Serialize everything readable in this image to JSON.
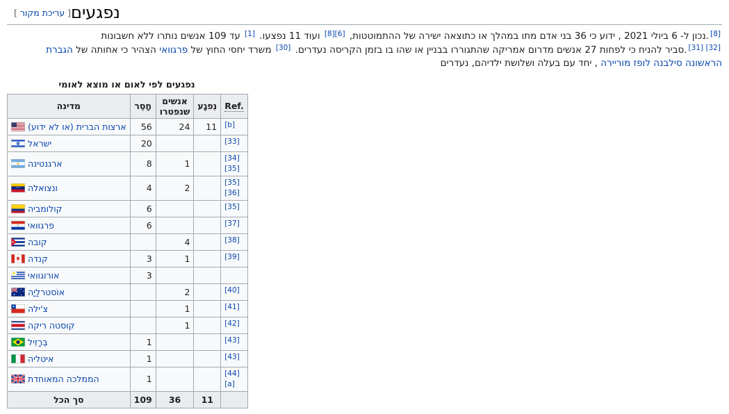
{
  "heading": {
    "title": "נפגעים",
    "edit_open": "[ ",
    "edit_label": "עריכת מקור",
    "edit_close": " ]"
  },
  "paragraph": {
    "line1": [
      {
        "type": "ref",
        "text": "[8]"
      },
      {
        "type": "text",
        "text": ".נכון ל- 6 ביולי 2021 , ידוע כי 36 בני אדם מתו במהלך או כתוצאה ישירה של ההתמוטטות, "
      },
      {
        "type": "ref",
        "text": "[8][6]"
      },
      {
        "type": "text",
        "text": " ועוד 11 נפצעו. "
      },
      {
        "type": "ref",
        "text": "[1]"
      },
      {
        "type": "text",
        "text": " עד 109 אנשים נותרו ללא חשבונות"
      }
    ],
    "line2": [
      {
        "type": "ref",
        "text": "[31] [32]"
      },
      {
        "type": "text",
        "text": ".סביר להניח כי לפחות 27 אנשים מדרום אמריקה שהתגוררו בבניין או שהו בו בזמן הקריסה נעדרים. "
      },
      {
        "type": "ref",
        "text": "[30]"
      },
      {
        "type": "text",
        "text": " משרד יחסי החוץ של "
      },
      {
        "type": "link",
        "text": "פרגוואי"
      },
      {
        "type": "text",
        "text": " הצהיר כי אחותה של "
      },
      {
        "type": "link",
        "text": "הגברת הראשונה סילבנה לופז מוריירה"
      },
      {
        "type": "text",
        "text": " , יחד עם בעלה ושלושת ילדיהם, נעדרים"
      }
    ]
  },
  "table": {
    "caption": "נפגעים לפי לאום או מוצא לאומי",
    "headers": {
      "country": "מדינה",
      "missing": "חָסֵר",
      "died": "אנשים שנפטרו",
      "injured": "נִפגָע",
      "ref": "Ref."
    },
    "rows": [
      {
        "flag": "us",
        "country": "ארצות הברית (או לא ידוע)",
        "missing": "56",
        "died": "24",
        "injured": "11",
        "refs": [
          "[b]"
        ]
      },
      {
        "flag": "il",
        "country": "ישראל",
        "missing": "20",
        "died": "",
        "injured": "",
        "refs": [
          "[33]"
        ]
      },
      {
        "flag": "ar",
        "country": "ארגנטינה",
        "missing": "8",
        "died": "1",
        "injured": "",
        "refs": [
          "[34]",
          "[35]"
        ]
      },
      {
        "flag": "ve",
        "country": "ונצואלה",
        "missing": "4",
        "died": "2",
        "injured": "",
        "refs": [
          "[35]",
          "[36]"
        ]
      },
      {
        "flag": "co",
        "country": "קולומביה",
        "missing": "6",
        "died": "",
        "injured": "",
        "refs": [
          "[35]"
        ]
      },
      {
        "flag": "py",
        "country": "פרגוואי",
        "missing": "6",
        "died": "",
        "injured": "",
        "refs": [
          "[37]"
        ]
      },
      {
        "flag": "cu",
        "country": "קובה",
        "missing": "",
        "died": "4",
        "injured": "",
        "refs": [
          "[38]"
        ]
      },
      {
        "flag": "ca",
        "country": "קנדה",
        "missing": "3",
        "died": "1",
        "injured": "",
        "refs": [
          "[39]"
        ]
      },
      {
        "flag": "uy",
        "country": "אורוגוואי",
        "missing": "3",
        "died": "",
        "injured": "",
        "refs": []
      },
      {
        "flag": "au",
        "country": "אוֹסטרלַיָה",
        "missing": "",
        "died": "2",
        "injured": "",
        "refs": [
          "[40]"
        ]
      },
      {
        "flag": "cl",
        "country": "צ'ילה",
        "missing": "",
        "died": "1",
        "injured": "",
        "refs": [
          "[41]"
        ]
      },
      {
        "flag": "cr",
        "country": "קוסטה ריקה",
        "missing": "",
        "died": "1",
        "injured": "",
        "refs": [
          "[42]"
        ]
      },
      {
        "flag": "br",
        "country": "בְּרָזִיל",
        "missing": "1",
        "died": "",
        "injured": "",
        "refs": [
          "[43]"
        ]
      },
      {
        "flag": "it",
        "country": "איטליה",
        "missing": "1",
        "died": "",
        "injured": "",
        "refs": [
          "[43]"
        ]
      },
      {
        "flag": "gb",
        "country": "הממלכה המאוחדת",
        "missing": "1",
        "died": "",
        "injured": "",
        "refs": [
          "[44]",
          "[a]"
        ]
      }
    ],
    "total": {
      "label": "סך הכל",
      "missing": "109",
      "died": "36",
      "injured": "11"
    }
  },
  "colors": {
    "link": "#0645ad",
    "border": "#a2a9b1",
    "header_bg": "#eaecf0",
    "table_bg": "#f8f9fa",
    "edit_bracket": "#54595d"
  }
}
